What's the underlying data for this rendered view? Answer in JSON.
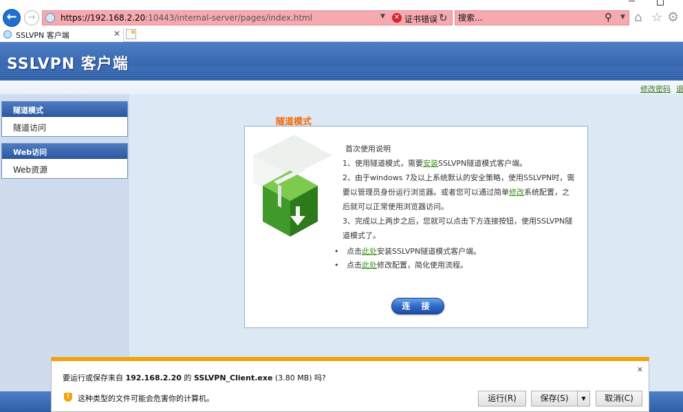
{
  "browser": {
    "url_host": "https://192.168.2.20",
    "url_path": ":10443/internal-server/pages/index.html",
    "cert_error": "证书错误",
    "search_placeholder": "搜索...",
    "tab_title": "SSLVPN 客户端"
  },
  "header": {
    "title": "SSLVPN 客户端",
    "links": [
      "修改密码",
      "退出"
    ]
  },
  "sidebar": {
    "groups": [
      {
        "title": "隧道模式",
        "items": [
          "隧道访问"
        ]
      },
      {
        "title": "Web访问",
        "items": [
          "Web资源"
        ]
      }
    ]
  },
  "main": {
    "box_title": "隧道模式",
    "intro_heading": "首次使用说明",
    "step1_prefix": "1、使用隧道模式，需要",
    "step1_link": "安装",
    "step1_suffix": "SSLVPN隧道模式客户端。",
    "step2_prefix": "2、由于windows 7及以上系统默认的安全策略，使用SSLVPN时，需要以管理员身份运行浏览器。或者您可以通过简单",
    "step2_link": "修改",
    "step2_suffix": "系统配置，之后就可以正常使用浏览器访问。",
    "step3": "3、完成以上两步之后，您就可以点击下方连接按钮，使用SSLVPN隧道模式了。",
    "bullet1_prefix": "点击",
    "bullet1_link": "此处",
    "bullet1_suffix": "安装SSLVPN隧道模式客户端。",
    "bullet2_prefix": "点击",
    "bullet2_link": "此处",
    "bullet2_suffix": "修改配置，简化使用流程。",
    "connect_label": "连 接"
  },
  "download": {
    "msg_prefix": "要运行或保存来自",
    "host": "192.168.2.20",
    "msg_mid": "的",
    "filename": "SSLVPN_Client.exe",
    "size": "(3.80 MB)",
    "msg_suffix": "吗?",
    "warning": "这种类型的文件可能会危害你的计算机。",
    "run_label": "运行(R)",
    "save_label": "保存(S)",
    "cancel_label": "取消(C)"
  },
  "colors": {
    "accent": "#2d5ea7",
    "title_orange": "#f06a06",
    "link_green": "#3b8f1c",
    "address_bar_error": "#f6aab0",
    "download_bar_accent": "#f0a30a"
  },
  "icons": [
    "back-icon",
    "forward-icon",
    "page-icon",
    "cert-error-icon",
    "refresh-icon",
    "search-icon",
    "home-icon",
    "favorites-star-icon",
    "settings-gear-icon",
    "tab-close-icon",
    "new-tab-icon",
    "package-icon",
    "shield-warning-icon",
    "close-icon"
  ]
}
